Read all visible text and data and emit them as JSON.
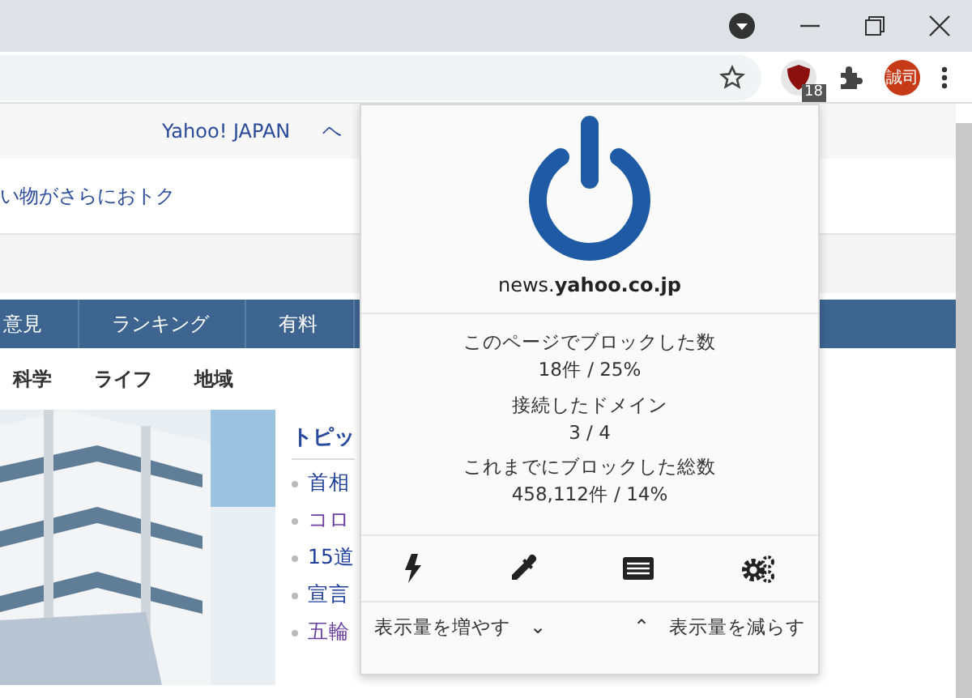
{
  "browser": {
    "extension_badge": "18",
    "avatar": "誠司"
  },
  "page": {
    "header_links": [
      "Yahoo! JAPAN",
      "ヘ"
    ],
    "promo": "い物がさらにおトク",
    "nav": [
      "意見",
      "ランキング",
      "有料"
    ],
    "subnav": [
      "科学",
      "ライフ",
      "地域"
    ],
    "topics_title": "トピッ",
    "topics": [
      {
        "text": "首相",
        "visited": false
      },
      {
        "text": "コロ",
        "visited": true
      },
      {
        "text": "15道",
        "visited": false
      },
      {
        "text": "宣言",
        "visited": false
      },
      {
        "text": "五輪",
        "visited": true
      }
    ]
  },
  "popup": {
    "domain": "news.**yahoo.co.jp**",
    "stats": [
      {
        "label": "このページでブロックした数",
        "value": "18件 / 25%"
      },
      {
        "label": "接続したドメイン",
        "value": "3 / 4"
      },
      {
        "label": "これまでにブロックした総数",
        "value": "458,112件 / 14%"
      }
    ],
    "tools": [
      {
        "kind": "zap"
      },
      {
        "kind": "picker"
      },
      {
        "kind": "logger"
      },
      {
        "kind": "settings"
      }
    ],
    "more": "表示量を増やす",
    "more_icon": "⌄",
    "less_icon": "⌃",
    "less": "表示量を減らす"
  }
}
